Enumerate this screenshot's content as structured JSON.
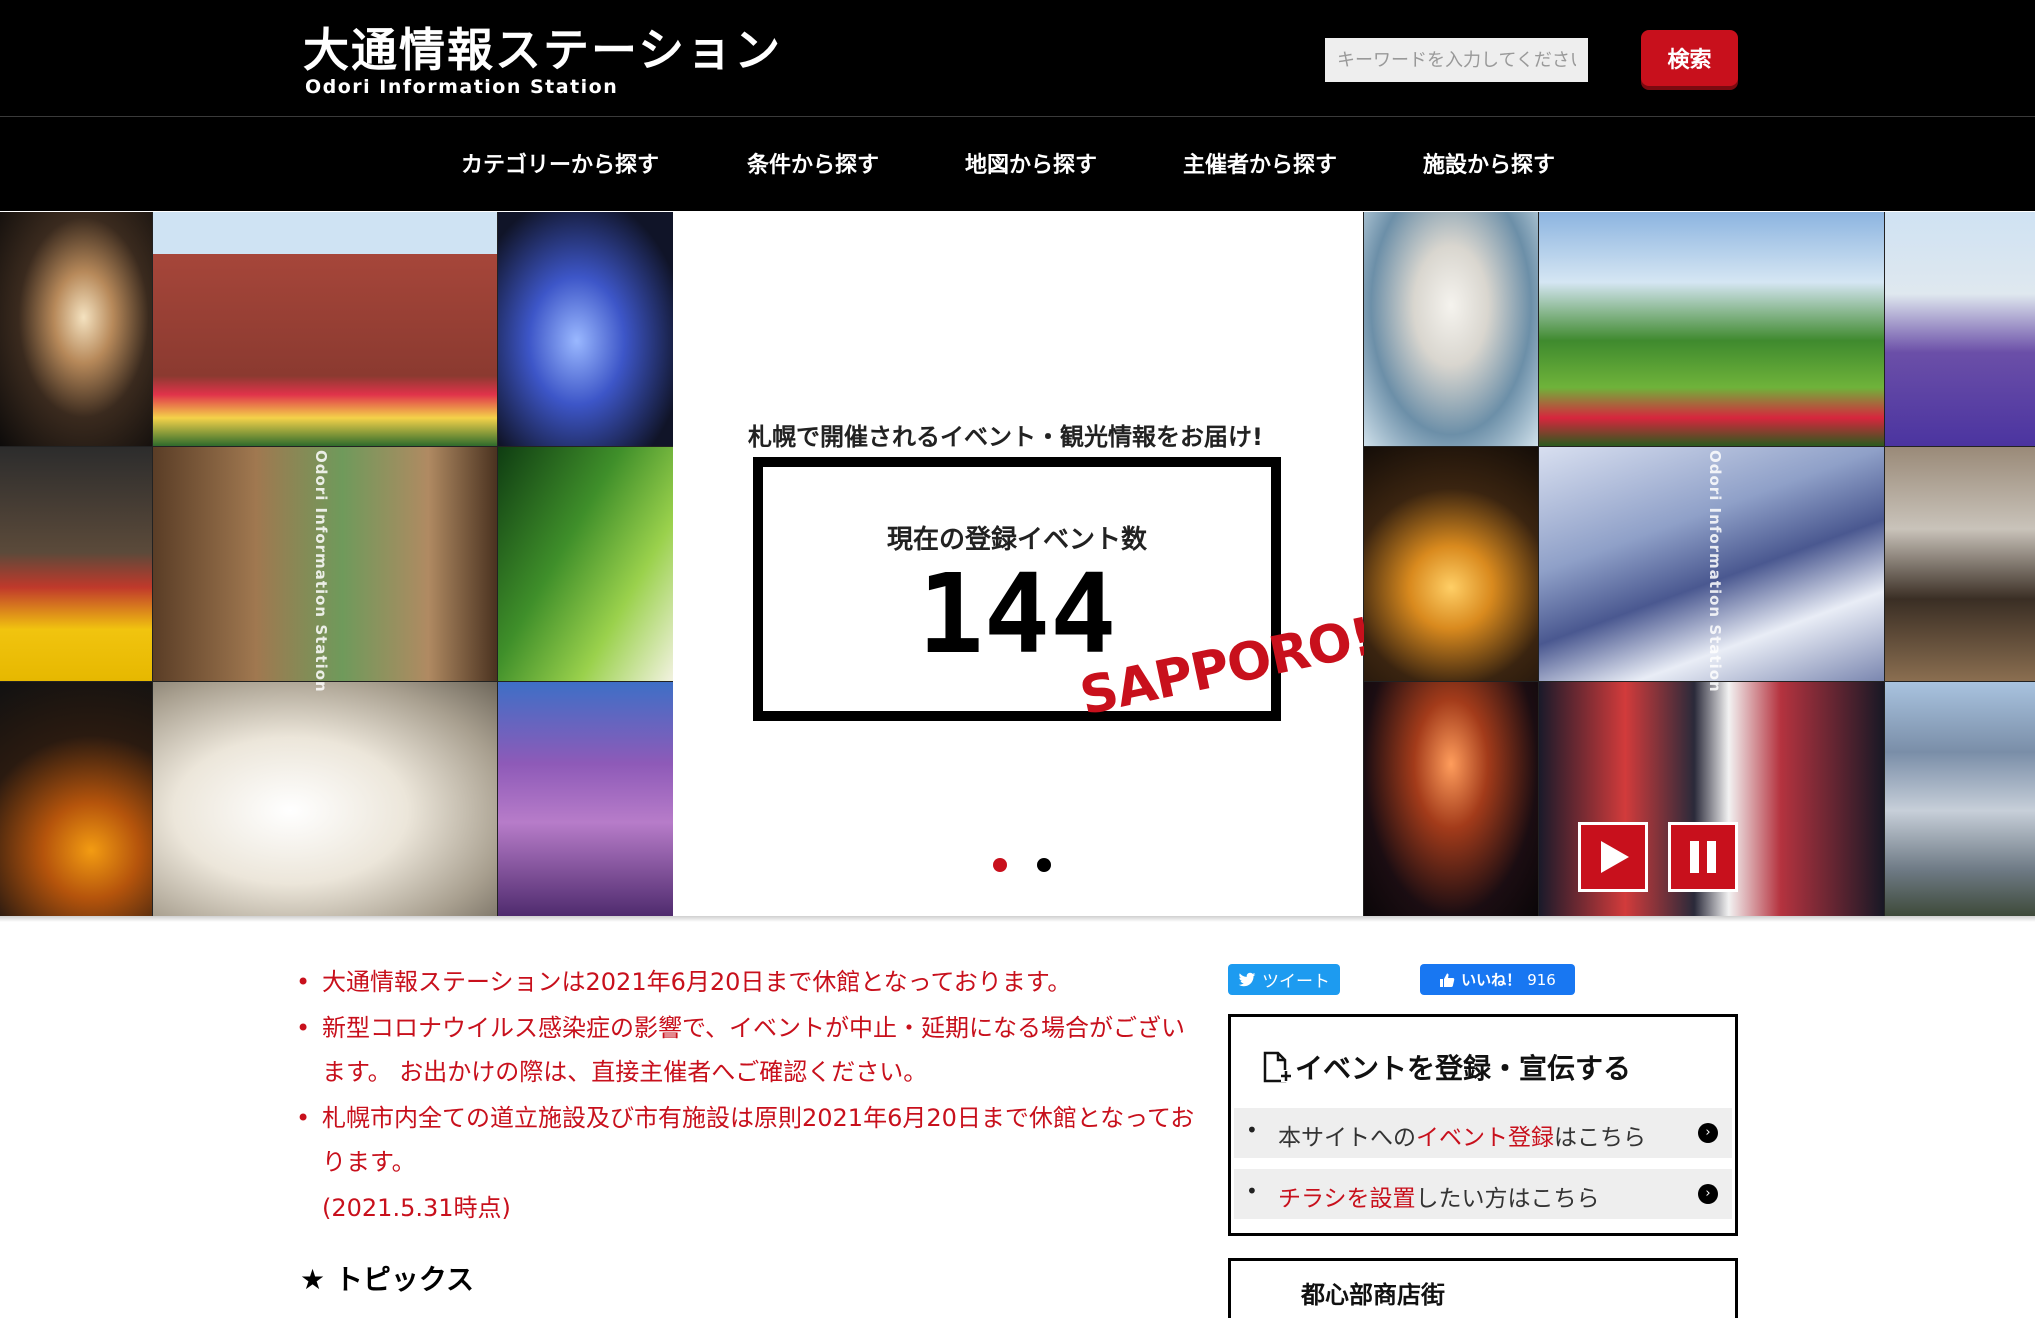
{
  "header": {
    "logo_jp": "大通情報ステーション",
    "logo_en": "Odori Information Station",
    "search_placeholder": "キーワードを入力してください",
    "search_button": "検索"
  },
  "nav": [
    {
      "label": "カテゴリーから探す"
    },
    {
      "label": "条件から探す"
    },
    {
      "label": "地図から探す"
    },
    {
      "label": "主催者から探す"
    },
    {
      "label": "施設から探す"
    }
  ],
  "hero": {
    "tagline": "札幌で開催されるイベント・観光情報をお届け!",
    "count_label": "現在の登録イベント数",
    "count_value": "144",
    "stamp": "SAPPORO!",
    "vertical_text": "Odori Information Station",
    "slides_total": 2,
    "active_slide": 1
  },
  "notices": [
    "大通情報ステーションは2021年6月20日まで休館となっております。",
    "新型コロナウイルス感染症の影響で、イベントが中止・延期になる場合がございます。 お出かけの際は、直接主催者へご確認ください。",
    "札幌市内全ての道立施設及び市有施設は原則2021年6月20日まで休館となっております。"
  ],
  "notice_date": "(2021.5.31時点)",
  "topics": {
    "heading": "トピックス"
  },
  "social": {
    "tweet": "ツイート",
    "like": "いいね！",
    "like_count": "916"
  },
  "register": {
    "title": "イベントを登録・宣伝する",
    "rows": [
      {
        "pre": "本サイトへの",
        "red": "イベント登録",
        "post": "はこちら"
      },
      {
        "pre": "",
        "red": "チラシを設置",
        "post": "したい方はこちら"
      }
    ]
  },
  "second_box": {
    "title": "都心部商店街"
  },
  "colors": {
    "brand_red": "#c8101c",
    "header_bg": "#000000",
    "tweet_blue": "#1d9bf0",
    "facebook_blue": "#1877f2"
  }
}
